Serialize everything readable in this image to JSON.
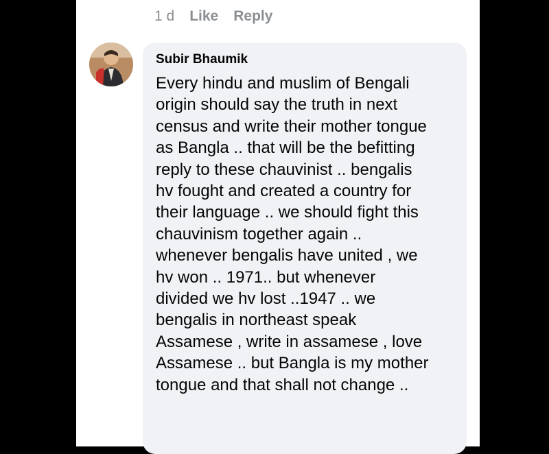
{
  "previous_comment": {
    "time": "1 d",
    "like_label": "Like",
    "reply_label": "Reply"
  },
  "comment": {
    "author": "Subir Bhaumik",
    "text": "Every hindu and muslim of Bengali\norigin should say the truth in next\ncensus and write their mother tongue\nas Bangla .. that will be the befitting\nreply to these chauvinist .. bengalis\nhv fought and created a country for\ntheir language .. we should fight this\nchauvinism together again ..\nwhenever bengalis have united , we\nhv won .. 1971.. but whenever\ndivided we hv lost ..1947 .. we\nbengalis in northeast speak\nAssamese , write in assamese , love\nAssamese .. but Bangla is my mother\ntongue and that shall not change .."
  },
  "colors": {
    "background": "#000000",
    "screen": "#ffffff",
    "bubble": "#f0f2f5",
    "meta_text": "#8a8d91",
    "body_text": "#050505"
  }
}
